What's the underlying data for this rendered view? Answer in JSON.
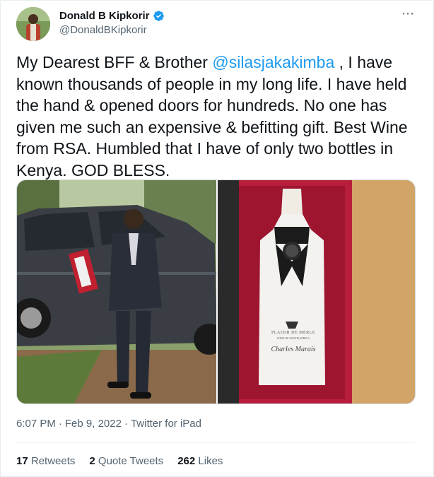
{
  "author": {
    "display_name": "Donald B Kipkorir",
    "handle": "@DonaldBKipkorir",
    "verified_icon": "verified-badge-icon",
    "accent": "#1d9bf0"
  },
  "more_icon": "⋯",
  "tweet": {
    "text_before": "My Dearest BFF & Brother ",
    "mention": "@silasjakakimba",
    "text_after": " , I have known thousands of people in my long life. I have held the hand & opened doors for hundreds. No one has given me such an expensive & befitting gift. Best Wine from RSA. Humbled that I have of only two bottles in Kenya. GOD BLESS."
  },
  "media": {
    "label_1": "PLAISIR DE MERLE",
    "label_2": "Charles Marais",
    "label_3": "WINE OF SOUTH AFRICA"
  },
  "meta": {
    "time": "6:07 PM",
    "separator": "·",
    "date": "Feb 9, 2022",
    "source": "Twitter for iPad"
  },
  "stats": {
    "retweets_count": "17",
    "retweets_label": "Retweets",
    "quotes_count": "2",
    "quotes_label": "Quote Tweets",
    "likes_count": "262",
    "likes_label": "Likes"
  }
}
